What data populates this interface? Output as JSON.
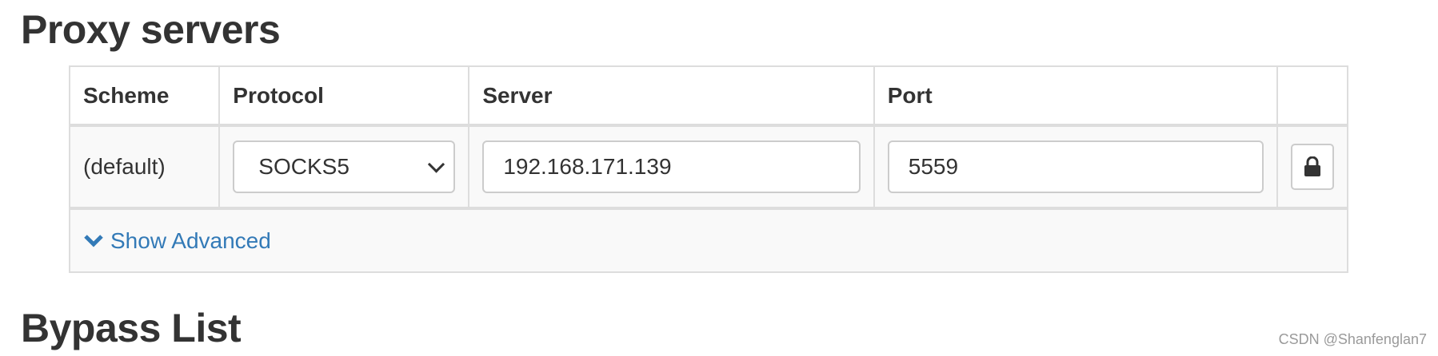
{
  "sections": {
    "proxy_title": "Proxy servers",
    "bypass_title": "Bypass List"
  },
  "table": {
    "headers": [
      "Scheme",
      "Protocol",
      "Server",
      "Port",
      ""
    ],
    "row": {
      "scheme": "(default)",
      "protocol": "SOCKS5",
      "server": "192.168.171.139",
      "port": "5559"
    },
    "show_advanced_label": "Show Advanced",
    "lock_icon": "lock-icon",
    "show_advanced_icon": "chevron-down-icon"
  },
  "watermark": "CSDN @Shanfenglan7",
  "colors": {
    "link": "#337ab7",
    "border": "#dddddd",
    "row_bg": "#f9f9f9"
  }
}
